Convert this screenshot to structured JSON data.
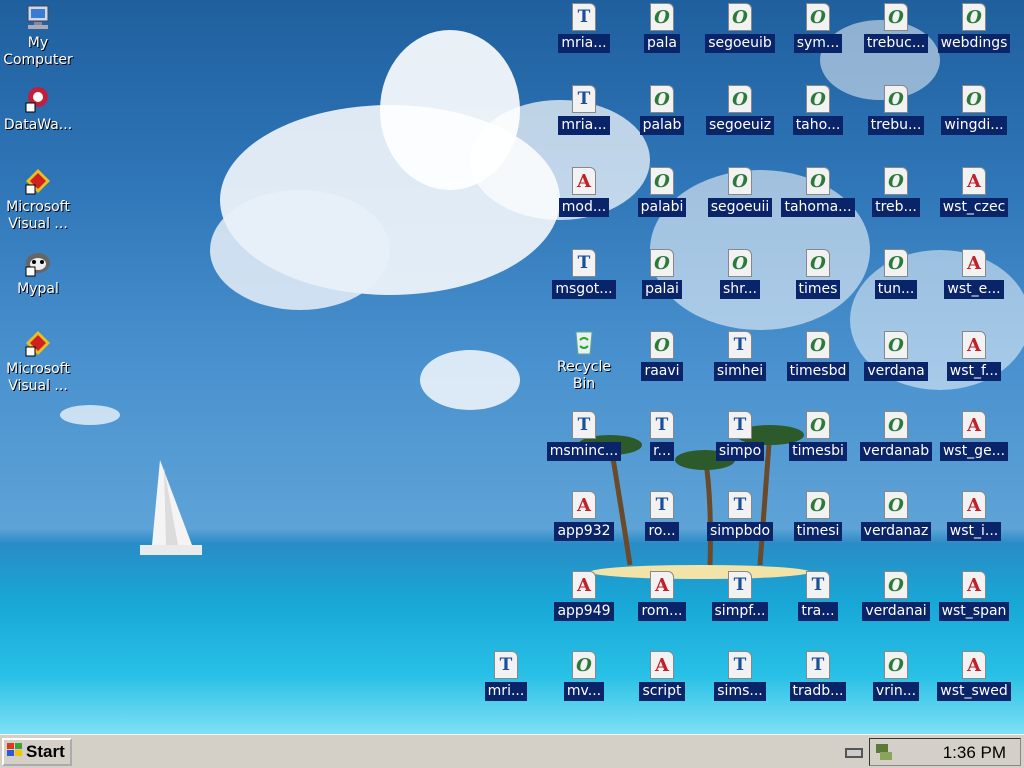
{
  "desktop": {
    "left_icons": [
      {
        "label": "My\nComputer",
        "icon": "computer-icon"
      },
      {
        "label": "DataWa...",
        "icon": "datawave-icon"
      },
      {
        "label": "Microsoft\nVisual ...",
        "icon": "visual-studio-icon"
      },
      {
        "label": "Mypal",
        "icon": "mypal-icon"
      },
      {
        "label": "Microsoft\nVisual ...",
        "icon": "visual-studio-icon"
      }
    ],
    "recycle_bin": {
      "label": "Recycle\nBin",
      "icon": "recycle-bin-icon"
    },
    "font_files": [
      {
        "label": "mria...",
        "type": "T"
      },
      {
        "label": "pala",
        "type": "O"
      },
      {
        "label": "segoeuib",
        "type": "O"
      },
      {
        "label": "sym...",
        "type": "O"
      },
      {
        "label": "trebuc...",
        "type": "O"
      },
      {
        "label": "webdings",
        "type": "O"
      },
      {
        "label": "mria...",
        "type": "T"
      },
      {
        "label": "palab",
        "type": "O"
      },
      {
        "label": "segoeuiz",
        "type": "O"
      },
      {
        "label": "taho...",
        "type": "O"
      },
      {
        "label": "trebu...",
        "type": "O"
      },
      {
        "label": "wingdi...",
        "type": "O"
      },
      {
        "label": "mod...",
        "type": "A"
      },
      {
        "label": "palabi",
        "type": "O"
      },
      {
        "label": "segoeuii",
        "type": "O"
      },
      {
        "label": "tahoma...",
        "type": "O"
      },
      {
        "label": "treb...",
        "type": "O"
      },
      {
        "label": "wst_czec",
        "type": "A"
      },
      {
        "label": "msgot...",
        "type": "T"
      },
      {
        "label": "palai",
        "type": "O"
      },
      {
        "label": "shr...",
        "type": "O"
      },
      {
        "label": "times",
        "type": "O"
      },
      {
        "label": "tun...",
        "type": "O"
      },
      {
        "label": "wst_e...",
        "type": "A"
      },
      {
        "label": "raavi",
        "type": "O"
      },
      {
        "label": "simhei",
        "type": "T"
      },
      {
        "label": "timesbd",
        "type": "O"
      },
      {
        "label": "verdana",
        "type": "O"
      },
      {
        "label": "wst_f...",
        "type": "A"
      },
      {
        "label": "msminc...",
        "type": "T"
      },
      {
        "label": "r...",
        "type": "T"
      },
      {
        "label": "simpo",
        "type": "T"
      },
      {
        "label": "timesbi",
        "type": "O"
      },
      {
        "label": "verdanab",
        "type": "O"
      },
      {
        "label": "wst_ge...",
        "type": "A"
      },
      {
        "label": "app932",
        "type": "A"
      },
      {
        "label": "ro...",
        "type": "T"
      },
      {
        "label": "simpbdo",
        "type": "T"
      },
      {
        "label": "timesi",
        "type": "O"
      },
      {
        "label": "verdanaz",
        "type": "O"
      },
      {
        "label": "wst_i...",
        "type": "A"
      },
      {
        "label": "app949",
        "type": "A"
      },
      {
        "label": "rom...",
        "type": "A"
      },
      {
        "label": "simpf...",
        "type": "T"
      },
      {
        "label": "tra...",
        "type": "T"
      },
      {
        "label": "verdanai",
        "type": "O"
      },
      {
        "label": "wst_span",
        "type": "A"
      },
      {
        "label": "mri...",
        "type": "T"
      },
      {
        "label": "mv...",
        "type": "O"
      },
      {
        "label": "script",
        "type": "A"
      },
      {
        "label": "sims...",
        "type": "T"
      },
      {
        "label": "tradb...",
        "type": "T"
      },
      {
        "label": "vrin...",
        "type": "O"
      },
      {
        "label": "wst_swed",
        "type": "A"
      }
    ]
  },
  "taskbar": {
    "start_label": "Start",
    "clock": "1:36 PM"
  }
}
